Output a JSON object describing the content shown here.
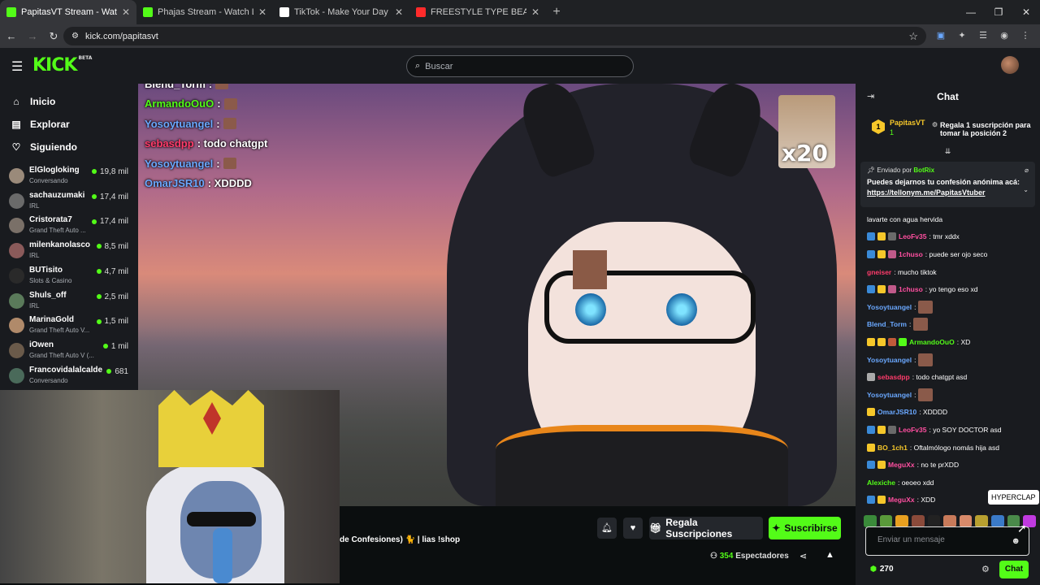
{
  "browser": {
    "tabs": [
      {
        "title": "PapitasVT Stream - Watch L",
        "icon_color": "#53fc18",
        "active": true
      },
      {
        "title": "Phajas Stream - Watch Live on",
        "icon_color": "#53fc18",
        "active": false
      },
      {
        "title": "TikTok - Make Your Day",
        "icon_color": "#ffffff",
        "active": false
      },
      {
        "title": "FREESTYLE TYPE BEAT - \"JUST L",
        "icon_color": "#ff2b2b",
        "active": false
      }
    ],
    "url": "kick.com/papitasvt"
  },
  "header": {
    "logo": "KICK",
    "logo_sup": "BETA",
    "search_placeholder": "Buscar"
  },
  "sidebar": {
    "nav": [
      {
        "label": "Inicio",
        "icon": "home-icon"
      },
      {
        "label": "Explorar",
        "icon": "compass-icon"
      },
      {
        "label": "Siguiendo",
        "icon": "heart-icon"
      }
    ],
    "channels": [
      {
        "name": "ElGlogloking",
        "category": "Conversando",
        "viewers": "19,8 mil",
        "color": "#9a8a7a"
      },
      {
        "name": "sachauzumaki",
        "category": "IRL",
        "viewers": "17,4 mil",
        "color": "#6a6a6a"
      },
      {
        "name": "Cristorata7",
        "category": "Grand Theft Auto ...",
        "viewers": "17,4 mil",
        "color": "#7a7068"
      },
      {
        "name": "milenkanolasco",
        "category": "IRL",
        "viewers": "8,5 mil",
        "color": "#8a5a5a"
      },
      {
        "name": "BUTisito",
        "category": "Slots & Casino",
        "viewers": "4,7 mil",
        "color": "#2a2a2a"
      },
      {
        "name": "Shuls_off",
        "category": "IRL",
        "viewers": "2,5 mil",
        "color": "#5a7a5a"
      },
      {
        "name": "MarinaGold",
        "category": "Grand Theft Auto V...",
        "viewers": "1,5 mil",
        "color": "#b08a6a"
      },
      {
        "name": "iOwen",
        "category": "Grand Theft Auto V (...",
        "viewers": "1 mil",
        "color": "#6a5a4a"
      },
      {
        "name": "Francovidalalcalde",
        "category": "Conversando",
        "viewers": "681",
        "color": "#4a6a5a"
      }
    ]
  },
  "overlay_chat": [
    {
      "user": "Blend_Torm",
      "text": ":",
      "color": "#ffffff"
    },
    {
      "user": "ArmandoOuO",
      "text": ":",
      "color": "#53fc18"
    },
    {
      "user": "Yosoytuangel",
      "text": ":",
      "color": "#6aa8ff"
    },
    {
      "user": "sebasdpp",
      "text": ": todo chatgpt",
      "color": "#ff3b6b"
    },
    {
      "user": "Yosoytuangel",
      "text": ":",
      "color": "#6aa8ff"
    },
    {
      "user": "OmarJSR10",
      "text": ": XDDDD",
      "color": "#6aa8ff"
    }
  ],
  "video": {
    "multiplier": "x20"
  },
  "stream": {
    "title": "de Confesiones) 🐈 | lias !shop",
    "gift_label": "Regala Suscripciones",
    "subscribe_label": "Suscribirse",
    "viewers": "354",
    "viewers_label": "Espectadores"
  },
  "chat": {
    "title": "Chat",
    "pinned": {
      "rank": "1",
      "user": "PapitasVT",
      "count": "1",
      "gift_text": "Regala 1 suscripción para tomar la posición 2"
    },
    "bot": {
      "sent_by": "Enviado por",
      "bot_name": "BotRix",
      "message": "Puedes dejarnos tu confesión anónima acá:",
      "link": "https://tellonym.me/PapitasVtuber"
    },
    "messages": [
      {
        "user": "",
        "text": "lavarte con agua hervida",
        "color": "#ffffff",
        "badges": [],
        "emote": false
      },
      {
        "user": "LeoFv35",
        "text": ": tmr xddx",
        "color": "#ff4fa0",
        "badges": [
          "#3a8ad8",
          "#f6c72a",
          "#6a6a6a"
        ],
        "emote": false
      },
      {
        "user": "1chuso",
        "text": ": puede ser ojo seco",
        "color": "#ff4fa0",
        "badges": [
          "#3a8ad8",
          "#f6c72a",
          "#c05a8a"
        ],
        "emote": false
      },
      {
        "user": "gneiser",
        "text": ": mucho tiktok",
        "color": "#ff3b6b",
        "badges": [],
        "emote": false
      },
      {
        "user": "1chuso",
        "text": ": yo tengo eso xd",
        "color": "#ff4fa0",
        "badges": [
          "#3a8ad8",
          "#f6c72a",
          "#c05a8a"
        ],
        "emote": false
      },
      {
        "user": "Yosoytuangel",
        "text": ":",
        "color": "#6aa8ff",
        "badges": [],
        "emote": true
      },
      {
        "user": "Blend_Torm",
        "text": ":",
        "color": "#6aa8ff",
        "badges": [],
        "emote": true
      },
      {
        "user": "ArmandoOuO",
        "text": ": XD",
        "color": "#53fc18",
        "badges": [
          "#f6c72a",
          "#f6c72a",
          "#c05a3a",
          "#53fc18"
        ],
        "emote": false
      },
      {
        "user": "Yosoytuangel",
        "text": ":",
        "color": "#6aa8ff",
        "badges": [],
        "emote": true
      },
      {
        "user": "sebasdpp",
        "text": ": todo chatgpt asd",
        "color": "#ff3b6b",
        "badges": [
          "#aaaaaa"
        ],
        "emote": false
      },
      {
        "user": "Yosoytuangel",
        "text": ":",
        "color": "#6aa8ff",
        "badges": [],
        "emote": true
      },
      {
        "user": "OmarJSR10",
        "text": ": XDDDD",
        "color": "#6aa8ff",
        "badges": [
          "#f6c72a"
        ],
        "emote": false
      },
      {
        "user": "LeoFv35",
        "text": ": yo SOY DOCTOR asd",
        "color": "#ff4fa0",
        "badges": [
          "#3a8ad8",
          "#f6c72a",
          "#6a6a6a"
        ],
        "emote": false
      },
      {
        "user": "BO_1ch1",
        "text": ": Oftalmólogo nomás hija asd",
        "color": "#f6c72a",
        "badges": [
          "#f6c72a"
        ],
        "emote": false
      },
      {
        "user": "MeguXx",
        "text": ": no te prXDD",
        "color": "#ff4fa0",
        "badges": [
          "#3a8ad8",
          "#f6c72a"
        ],
        "emote": false
      },
      {
        "user": "Alexiche",
        "text": ": oeoeo xdd",
        "color": "#53fc18",
        "badges": [],
        "emote": false
      },
      {
        "user": "MeguXx",
        "text": ": XDD",
        "color": "#ff4fa0",
        "badges": [
          "#3a8ad8",
          "#f6c72a"
        ],
        "emote": false
      }
    ],
    "tooltip": "HYPERCLAP",
    "input_placeholder": "Enviar un mensaje",
    "points": "270",
    "send_label": "Chat"
  }
}
